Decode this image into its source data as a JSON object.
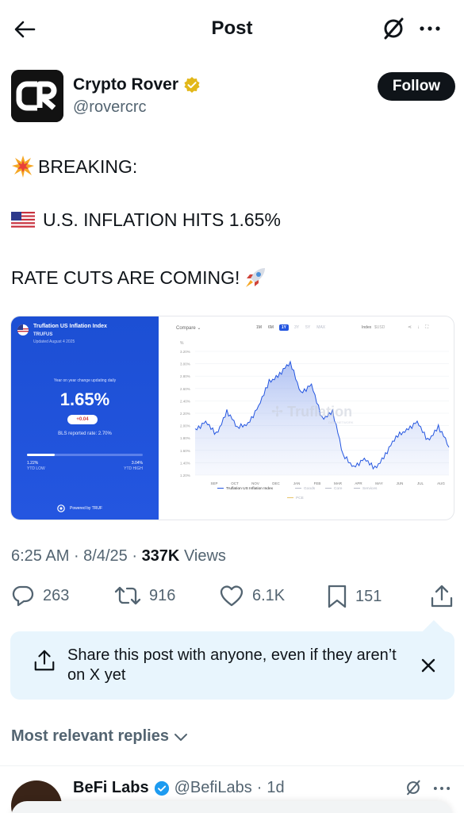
{
  "header": {
    "title": "Post"
  },
  "author": {
    "name": "Crypto Rover",
    "handle": "@rovercrc",
    "follow_label": "Follow"
  },
  "post": {
    "line1": "BREAKING:",
    "line2": "U.S. INFLATION HITS 1.65%",
    "line3": "RATE CUTS ARE COMING!"
  },
  "media": {
    "card_title": "Truflation US Inflation Index",
    "card_ticker": "TRUFUS",
    "card_updated": "Updated August 4 2025",
    "card_caption": "Year on year change updating daily",
    "card_value": "1.65%",
    "card_change": "+0.04",
    "card_bls": "BLS reported rate: 2.70%",
    "card_ytd_low_value": "1.22%",
    "card_ytd_low_label": "YTD LOW",
    "card_ytd_high_value": "3.04%",
    "card_ytd_high_label": "YTD HIGH",
    "card_powered": "Powered by TRUF",
    "compare_label": "Compare",
    "ranges": [
      "1M",
      "6M",
      "1Y",
      "3Y",
      "5Y",
      "MAX"
    ],
    "active_range": "1Y",
    "index_label": "Index",
    "usd_label": "$USD",
    "watermark": "Truflation",
    "watermark_sub": "DATA NETWORK"
  },
  "chart_data": {
    "type": "area",
    "ylabel": "%",
    "yticks": [
      "3.20%",
      "3.00%",
      "2.80%",
      "2.60%",
      "2.40%",
      "2.20%",
      "2.00%",
      "1.80%",
      "1.60%",
      "1.40%",
      "1.20%"
    ],
    "ylim": [
      1.2,
      3.2
    ],
    "categories": [
      "SEP",
      "OCT",
      "NOV",
      "DEC",
      "JAN",
      "FEB",
      "MAR",
      "APR",
      "MAY",
      "JUN",
      "JUL",
      "AUG"
    ],
    "series": [
      {
        "name": "Truflation US Inflation Index",
        "values": [
          1.95,
          2.05,
          1.85,
          2.25,
          1.95,
          2.05,
          2.3,
          2.7,
          2.85,
          3.0,
          2.55,
          2.65,
          2.1,
          2.25,
          1.5,
          1.35,
          1.45,
          1.3,
          1.55,
          1.8,
          1.95,
          2.05,
          1.75,
          2.0,
          1.65
        ]
      }
    ],
    "legend": [
      "Truflation US Inflation Index",
      "Goods",
      "Core",
      "Services",
      "PCE"
    ],
    "grid": true,
    "legend_position": "bottom"
  },
  "meta": {
    "time": "6:25 AM",
    "date": "8/4/25",
    "views_count": "337K",
    "views_label": "Views"
  },
  "actions": {
    "replies": "263",
    "reposts": "916",
    "likes": "6.1K",
    "bookmarks": "151"
  },
  "share_prompt": {
    "message": "Share this post with anyone, even if they aren’t on X yet"
  },
  "replies": {
    "sort_label": "Most relevant replies",
    "first": {
      "name": "BeFi Labs",
      "handle": "@BefiLabs",
      "age": "1d"
    }
  },
  "colors": {
    "accent": "#1d9bf0",
    "card_blue": "#2456e0",
    "verified_gold": "#e2b719"
  }
}
